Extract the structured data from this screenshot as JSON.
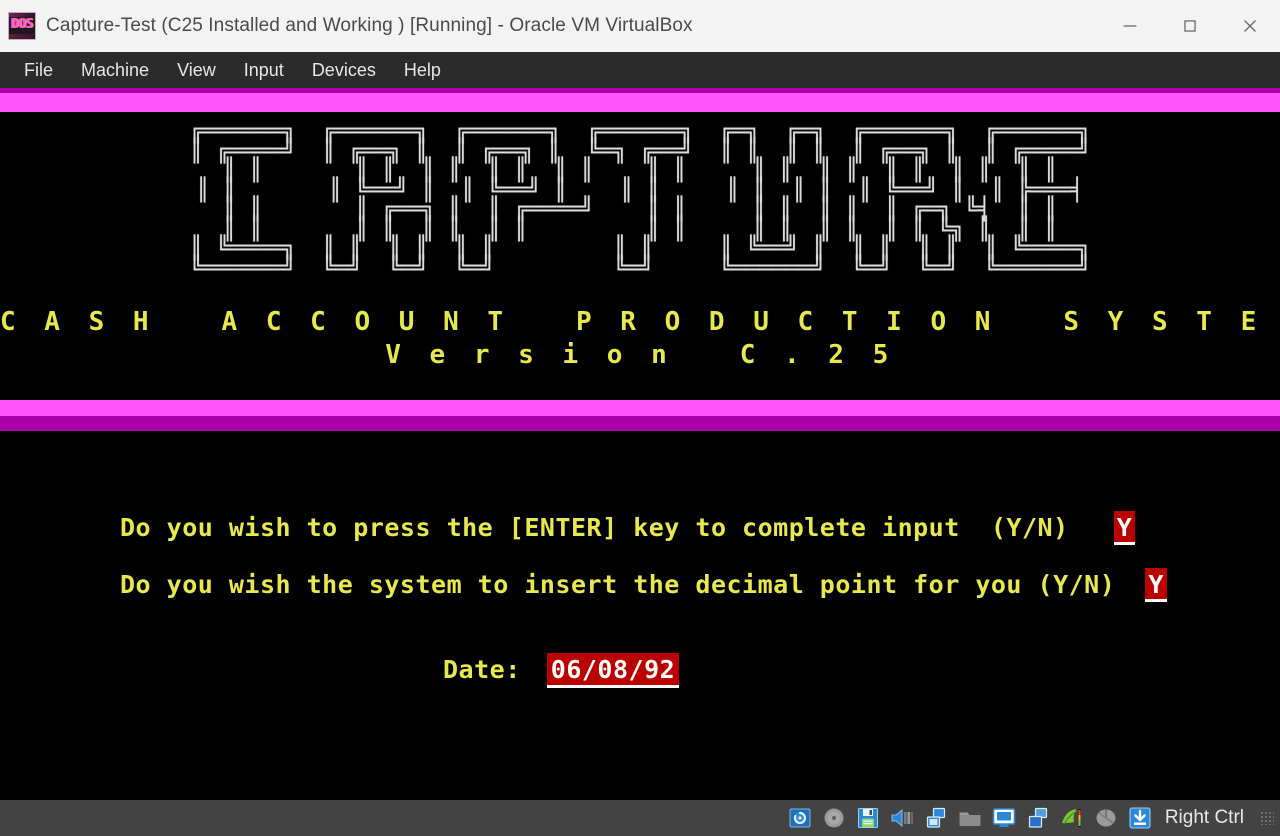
{
  "window": {
    "title": "Capture-Test (C25 Installed and Working ) [Running] - Oracle VM VirtualBox",
    "icon_name": "dos-app-icon",
    "icon_text": "DOS",
    "controls": {
      "minimize": "minimize-icon",
      "maximize": "maximize-icon",
      "close": "close-icon"
    }
  },
  "menubar": {
    "items": [
      {
        "label": "File"
      },
      {
        "label": "Machine"
      },
      {
        "label": "View"
      },
      {
        "label": "Input"
      },
      {
        "label": "Devices"
      },
      {
        "label": "Help"
      }
    ]
  },
  "vm_screen": {
    "colors": {
      "background": "#000000",
      "magenta_bright": "#ff55ff",
      "magenta_dark": "#aa00aa",
      "yellow": "#e8e84e",
      "white": "#dcdcdc",
      "field_red": "#bb0000",
      "field_text": "#ffffff"
    },
    "ascii_logo_lines": [
      "╔══════╗  ╔══════╗  ╔══════╗  ╔══════╗  ╔═╗  ╔═╗  ╔══════╗  ╔══════╗",
      "║ ╔════╝  ║ ╔══╗ ║  ║ ╔══╗ ║  ╚═╗ ╔══╝  ║ ║  ║ ║  ║ ╔══╗ ║  ║ ╔════╝",
      "║ ║       ║ ║  ║ ║  ║ ║  ║ ║    ║ ║     ║ ║  ║ ║  ║ ║  ║ ║  ║ ║",
      "║ ║       ║ ╚══╝ ║  ║ ╚══╝ ║    ║ ║     ║ ║  ║ ║  ║ ╚══╝ ║  ║ ╠═══╡",
      "║ ║       ║ ╔══╗ ║  ║ ╔════╝    ║ ║     ║ ║  ║ ║  ║ ╔═╗ ╚╡  ║ ║",
      "║ ║       ║ ║  ║ ║  ║ ║         ║ ║     ║ ║  ║ ║  ║ ║ ╚╗ ║  ║ ║",
      "║ ╚════╗  ║ ║  ║ ║  ║ ║         ║ ║     ║ ╚══╝ ║  ║ ║  ║ ║  ║ ╚════╗",
      "╚══════╝  ╚═╝  ╚═╝  ╚═╝         ╚═╝     ╚══════╝  ╚═╝  ╚═╝  ╚══════╝"
    ],
    "tagline": "C A S H   A C C O U N T   P R O D U C T I O N   S Y S T E M",
    "version": "V e r s i o n   C . 2 5",
    "prompts": [
      {
        "text": "Do you wish to press the [ENTER] key to complete input  (Y/N)",
        "value": "Y"
      },
      {
        "text": "Do you wish the system to insert the decimal point for you (Y/N)",
        "value": "Y"
      }
    ],
    "date_field": {
      "label": "Date:",
      "value": "06/08/92"
    }
  },
  "statusbar": {
    "icons": [
      {
        "name": "hard-disk-icon"
      },
      {
        "name": "optical-disc-icon"
      },
      {
        "name": "floppy-disk-icon"
      },
      {
        "name": "audio-icon"
      },
      {
        "name": "network-icon"
      },
      {
        "name": "shared-folders-icon"
      },
      {
        "name": "display-icon"
      },
      {
        "name": "usb-icon"
      },
      {
        "name": "video-capture-icon"
      },
      {
        "name": "mouse-icon"
      },
      {
        "name": "host-key-icon"
      }
    ],
    "host_key_label": "Right Ctrl"
  }
}
